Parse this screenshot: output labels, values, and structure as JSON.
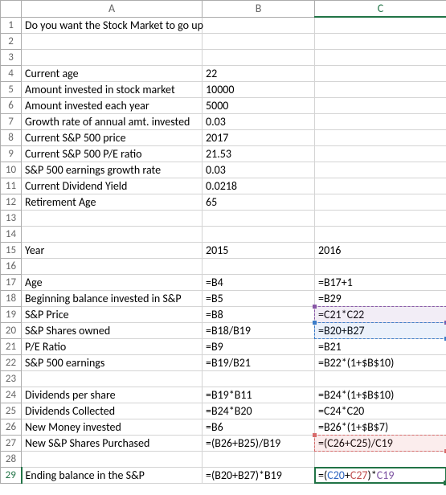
{
  "columns": [
    "A",
    "B",
    "C"
  ],
  "selectedRow": 29,
  "selectedCol": "C",
  "rows": [
    {
      "n": 1,
      "a": "Do you want the Stock Market to go up",
      "b": "",
      "c": ""
    },
    {
      "n": 2,
      "a": "",
      "b": "",
      "c": ""
    },
    {
      "n": 3,
      "a": "",
      "b": "",
      "c": ""
    },
    {
      "n": 4,
      "a": "Current age",
      "b": "22",
      "c": ""
    },
    {
      "n": 5,
      "a": "Amount invested in stock market",
      "b": "10000",
      "c": ""
    },
    {
      "n": 6,
      "a": "Amount invested each year",
      "b": "5000",
      "c": ""
    },
    {
      "n": 7,
      "a": "Growth rate of annual amt. invested",
      "b": "0.03",
      "c": ""
    },
    {
      "n": 8,
      "a": "Current S&P 500 price",
      "b": "2017",
      "c": ""
    },
    {
      "n": 9,
      "a": "Current S&P 500 P/E ratio",
      "b": "21.53",
      "c": ""
    },
    {
      "n": 10,
      "a": "S&P 500 earnings growth rate",
      "b": "0.03",
      "c": ""
    },
    {
      "n": 11,
      "a": "Current Dividend Yield",
      "b": "0.0218",
      "c": ""
    },
    {
      "n": 12,
      "a": "Retirement Age",
      "b": "65",
      "c": ""
    },
    {
      "n": 13,
      "a": "",
      "b": "",
      "c": ""
    },
    {
      "n": 14,
      "a": "",
      "b": "",
      "c": ""
    },
    {
      "n": 15,
      "a": "Year",
      "b": "2015",
      "c": "2016"
    },
    {
      "n": 16,
      "a": "",
      "b": "",
      "c": ""
    },
    {
      "n": 17,
      "a": "Age",
      "b": "=B4",
      "c": "=B17+1"
    },
    {
      "n": 18,
      "a": "Beginning balance invested in S&P",
      "b": "=B5",
      "c": "=B29"
    },
    {
      "n": 19,
      "a": "S&P Price",
      "b": "=B8",
      "c": "=C21*C22"
    },
    {
      "n": 20,
      "a": "S&P Shares owned",
      "b": "=B18/B19",
      "c": "=B20+B27"
    },
    {
      "n": 21,
      "a": "P/E Ratio",
      "b": "=B9",
      "c": "=B21"
    },
    {
      "n": 22,
      "a": "S&P 500 earnings",
      "b": "=B19/B21",
      "c": "=B22*(1+$B$10)"
    },
    {
      "n": 23,
      "a": "",
      "b": "",
      "c": ""
    },
    {
      "n": 24,
      "a": "Dividends per share",
      "b": "=B19*B11",
      "c": "=B24*(1+$B$10)"
    },
    {
      "n": 25,
      "a": "Dividends Collected",
      "b": "=B24*B20",
      "c": "=C24*C20"
    },
    {
      "n": 26,
      "a": "New Money invested",
      "b": "=B6",
      "c": "=B26*(1+$B$7)"
    },
    {
      "n": 27,
      "a": "New S&P Shares Purchased",
      "b": "=(B26+B25)/B19",
      "c": "=(C26+C25)/C19"
    },
    {
      "n": 28,
      "a": "",
      "b": "",
      "c": ""
    },
    {
      "n": 29,
      "a": "Ending balance in the S&P",
      "b": "=(B20+B27)*B19",
      "c": ""
    }
  ],
  "activeFormula": {
    "eq": "=",
    "open": "(",
    "ref1": "C20",
    "plus": "+",
    "ref2": "C27",
    "close": ")",
    "times": "*",
    "ref3": "C19"
  },
  "highlights": {
    "c19": "purple",
    "c20": "blue",
    "c27": "red",
    "c29": "green"
  }
}
